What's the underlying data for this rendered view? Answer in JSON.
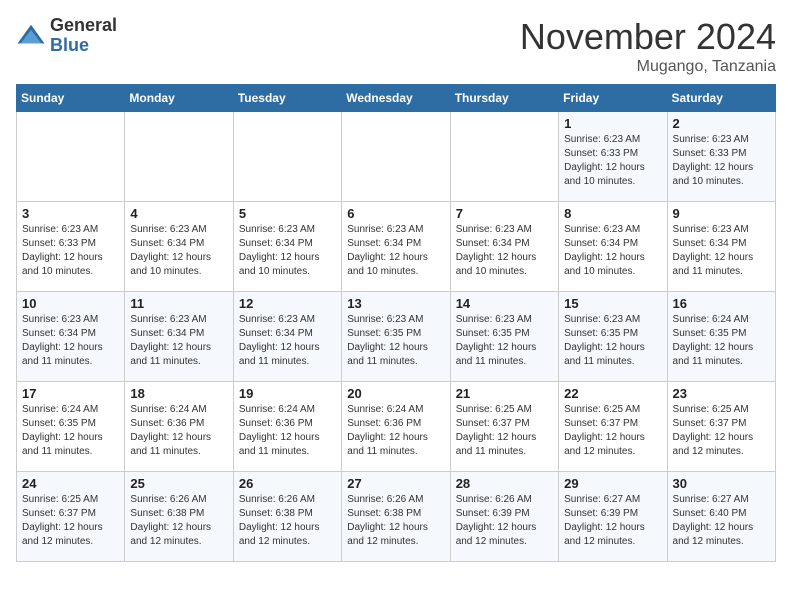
{
  "header": {
    "logo_line1": "General",
    "logo_line2": "Blue",
    "month": "November 2024",
    "location": "Mugango, Tanzania"
  },
  "weekdays": [
    "Sunday",
    "Monday",
    "Tuesday",
    "Wednesday",
    "Thursday",
    "Friday",
    "Saturday"
  ],
  "weeks": [
    [
      {
        "day": "",
        "info": ""
      },
      {
        "day": "",
        "info": ""
      },
      {
        "day": "",
        "info": ""
      },
      {
        "day": "",
        "info": ""
      },
      {
        "day": "",
        "info": ""
      },
      {
        "day": "1",
        "info": "Sunrise: 6:23 AM\nSunset: 6:33 PM\nDaylight: 12 hours and 10 minutes."
      },
      {
        "day": "2",
        "info": "Sunrise: 6:23 AM\nSunset: 6:33 PM\nDaylight: 12 hours and 10 minutes."
      }
    ],
    [
      {
        "day": "3",
        "info": "Sunrise: 6:23 AM\nSunset: 6:33 PM\nDaylight: 12 hours and 10 minutes."
      },
      {
        "day": "4",
        "info": "Sunrise: 6:23 AM\nSunset: 6:34 PM\nDaylight: 12 hours and 10 minutes."
      },
      {
        "day": "5",
        "info": "Sunrise: 6:23 AM\nSunset: 6:34 PM\nDaylight: 12 hours and 10 minutes."
      },
      {
        "day": "6",
        "info": "Sunrise: 6:23 AM\nSunset: 6:34 PM\nDaylight: 12 hours and 10 minutes."
      },
      {
        "day": "7",
        "info": "Sunrise: 6:23 AM\nSunset: 6:34 PM\nDaylight: 12 hours and 10 minutes."
      },
      {
        "day": "8",
        "info": "Sunrise: 6:23 AM\nSunset: 6:34 PM\nDaylight: 12 hours and 10 minutes."
      },
      {
        "day": "9",
        "info": "Sunrise: 6:23 AM\nSunset: 6:34 PM\nDaylight: 12 hours and 11 minutes."
      }
    ],
    [
      {
        "day": "10",
        "info": "Sunrise: 6:23 AM\nSunset: 6:34 PM\nDaylight: 12 hours and 11 minutes."
      },
      {
        "day": "11",
        "info": "Sunrise: 6:23 AM\nSunset: 6:34 PM\nDaylight: 12 hours and 11 minutes."
      },
      {
        "day": "12",
        "info": "Sunrise: 6:23 AM\nSunset: 6:34 PM\nDaylight: 12 hours and 11 minutes."
      },
      {
        "day": "13",
        "info": "Sunrise: 6:23 AM\nSunset: 6:35 PM\nDaylight: 12 hours and 11 minutes."
      },
      {
        "day": "14",
        "info": "Sunrise: 6:23 AM\nSunset: 6:35 PM\nDaylight: 12 hours and 11 minutes."
      },
      {
        "day": "15",
        "info": "Sunrise: 6:23 AM\nSunset: 6:35 PM\nDaylight: 12 hours and 11 minutes."
      },
      {
        "day": "16",
        "info": "Sunrise: 6:24 AM\nSunset: 6:35 PM\nDaylight: 12 hours and 11 minutes."
      }
    ],
    [
      {
        "day": "17",
        "info": "Sunrise: 6:24 AM\nSunset: 6:35 PM\nDaylight: 12 hours and 11 minutes."
      },
      {
        "day": "18",
        "info": "Sunrise: 6:24 AM\nSunset: 6:36 PM\nDaylight: 12 hours and 11 minutes."
      },
      {
        "day": "19",
        "info": "Sunrise: 6:24 AM\nSunset: 6:36 PM\nDaylight: 12 hours and 11 minutes."
      },
      {
        "day": "20",
        "info": "Sunrise: 6:24 AM\nSunset: 6:36 PM\nDaylight: 12 hours and 11 minutes."
      },
      {
        "day": "21",
        "info": "Sunrise: 6:25 AM\nSunset: 6:37 PM\nDaylight: 12 hours and 11 minutes."
      },
      {
        "day": "22",
        "info": "Sunrise: 6:25 AM\nSunset: 6:37 PM\nDaylight: 12 hours and 12 minutes."
      },
      {
        "day": "23",
        "info": "Sunrise: 6:25 AM\nSunset: 6:37 PM\nDaylight: 12 hours and 12 minutes."
      }
    ],
    [
      {
        "day": "24",
        "info": "Sunrise: 6:25 AM\nSunset: 6:37 PM\nDaylight: 12 hours and 12 minutes."
      },
      {
        "day": "25",
        "info": "Sunrise: 6:26 AM\nSunset: 6:38 PM\nDaylight: 12 hours and 12 minutes."
      },
      {
        "day": "26",
        "info": "Sunrise: 6:26 AM\nSunset: 6:38 PM\nDaylight: 12 hours and 12 minutes."
      },
      {
        "day": "27",
        "info": "Sunrise: 6:26 AM\nSunset: 6:38 PM\nDaylight: 12 hours and 12 minutes."
      },
      {
        "day": "28",
        "info": "Sunrise: 6:26 AM\nSunset: 6:39 PM\nDaylight: 12 hours and 12 minutes."
      },
      {
        "day": "29",
        "info": "Sunrise: 6:27 AM\nSunset: 6:39 PM\nDaylight: 12 hours and 12 minutes."
      },
      {
        "day": "30",
        "info": "Sunrise: 6:27 AM\nSunset: 6:40 PM\nDaylight: 12 hours and 12 minutes."
      }
    ]
  ]
}
